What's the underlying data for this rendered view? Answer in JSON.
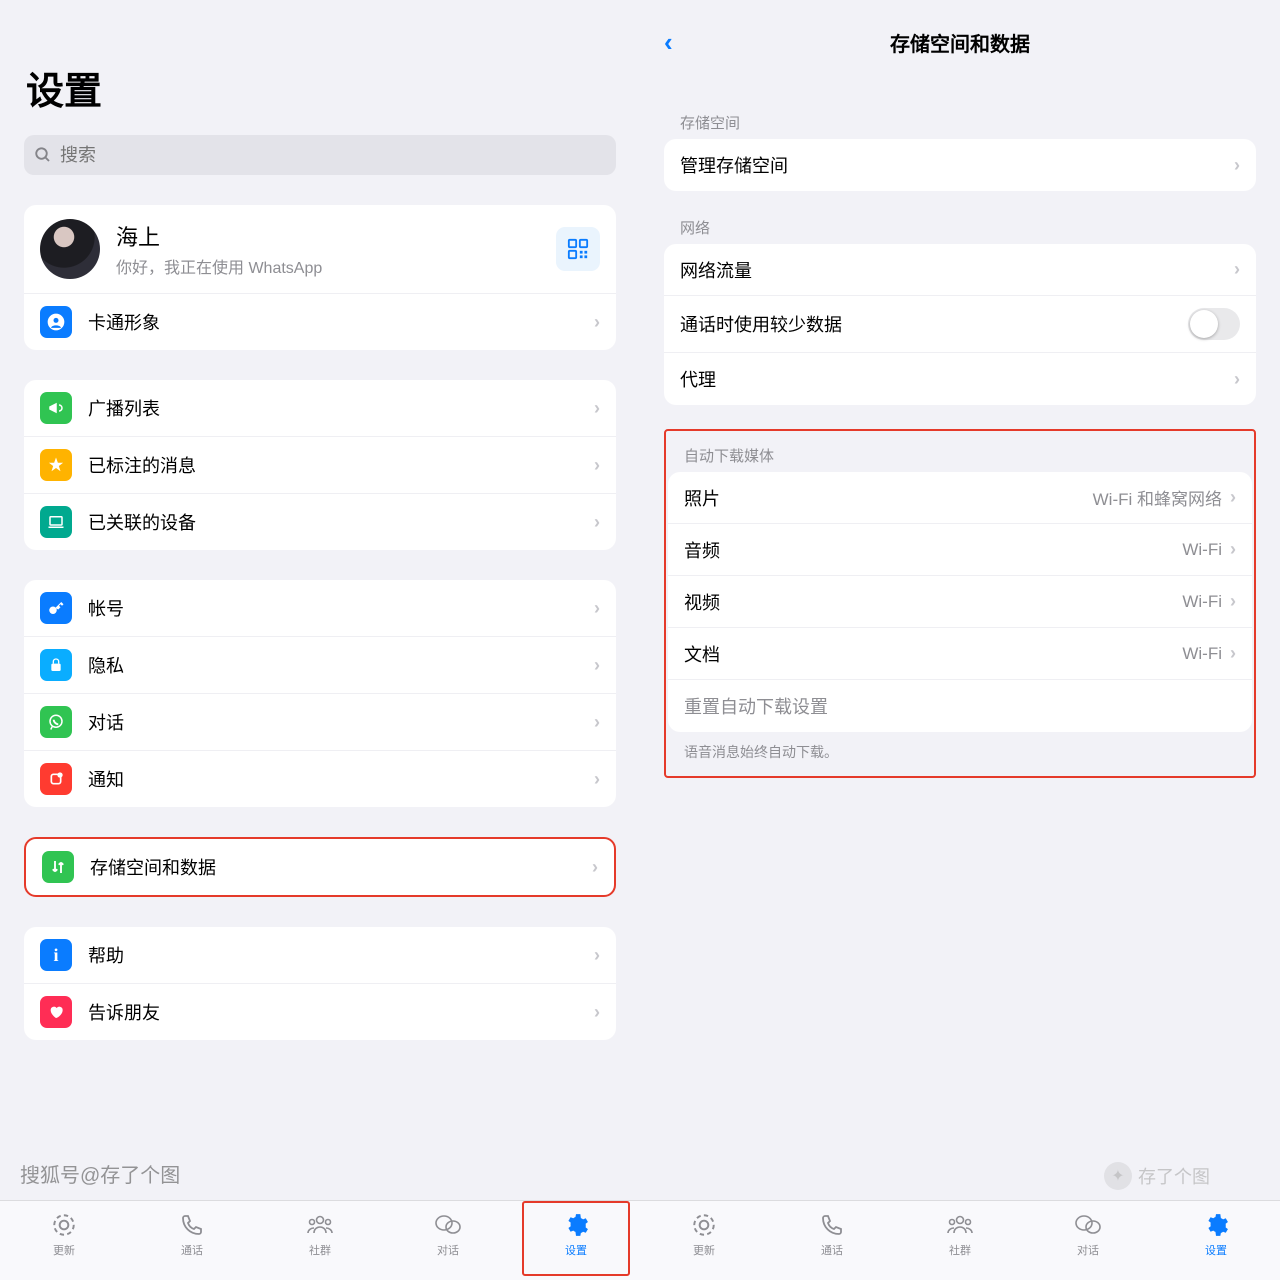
{
  "left": {
    "title": "设置",
    "search_placeholder": "搜索",
    "profile": {
      "name": "海上",
      "status": "你好，我正在使用 WhatsApp"
    },
    "avatar_row": "卡通形象",
    "group1": {
      "broadcast": "广播列表",
      "starred": "已标注的消息",
      "linked": "已关联的设备"
    },
    "group2": {
      "account": "帐号",
      "privacy": "隐私",
      "chats": "对话",
      "notifications": "通知",
      "storage": "存储空间和数据"
    },
    "group3": {
      "help": "帮助",
      "tell": "告诉朋友"
    }
  },
  "right": {
    "page_title": "存储空间和数据",
    "sec_storage": "存储空间",
    "manage_storage": "管理存储空间",
    "sec_network": "网络",
    "network_usage": "网络流量",
    "less_data_calls": "通话时使用较少数据",
    "proxy": "代理",
    "sec_autodl": "自动下载媒体",
    "photos": "照片",
    "photos_val": "Wi-Fi 和蜂窝网络",
    "audio": "音频",
    "audio_val": "Wi-Fi",
    "video": "视频",
    "video_val": "Wi-Fi",
    "docs": "文档",
    "docs_val": "Wi-Fi",
    "reset": "重置自动下载设置",
    "note": "语音消息始终自动下载。"
  },
  "tabs": {
    "updates": "更新",
    "calls": "通话",
    "communities": "社群",
    "chats": "对话",
    "settings": "设置"
  },
  "watermark1": "搜狐号@存了个图",
  "watermark2": "存了个图"
}
